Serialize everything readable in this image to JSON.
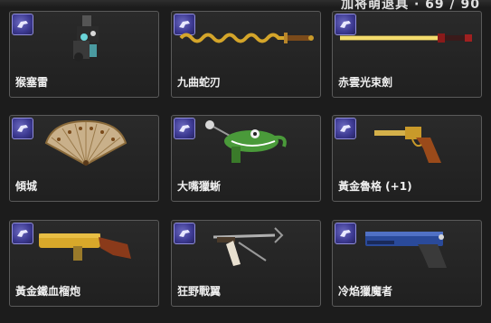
{
  "header": {
    "partial_text": "加将萌退具 · 69 / 90"
  },
  "items": [
    {
      "name": "猴塞雷",
      "icon": "gatling-gun-icon"
    },
    {
      "name": "九曲蛇刃",
      "icon": "serpent-sword-icon"
    },
    {
      "name": "赤雲光束劍",
      "icon": "beam-sword-icon"
    },
    {
      "name": "傾城",
      "icon": "feather-fan-icon"
    },
    {
      "name": "大嘴獵蜥",
      "icon": "lizard-gun-icon"
    },
    {
      "name": "黃金魯格 (+1)",
      "icon": "golden-luger-icon"
    },
    {
      "name": "黃金鐵血榴炮",
      "icon": "grenade-launcher-icon"
    },
    {
      "name": "狂野戰翼",
      "icon": "wild-pistol-icon"
    },
    {
      "name": "冷焰獵魔者",
      "icon": "blue-pistol-icon"
    }
  ],
  "colors": {
    "badge": "#3b3890",
    "card_border": "#5a5a5a",
    "background": "#1c1c1c"
  }
}
